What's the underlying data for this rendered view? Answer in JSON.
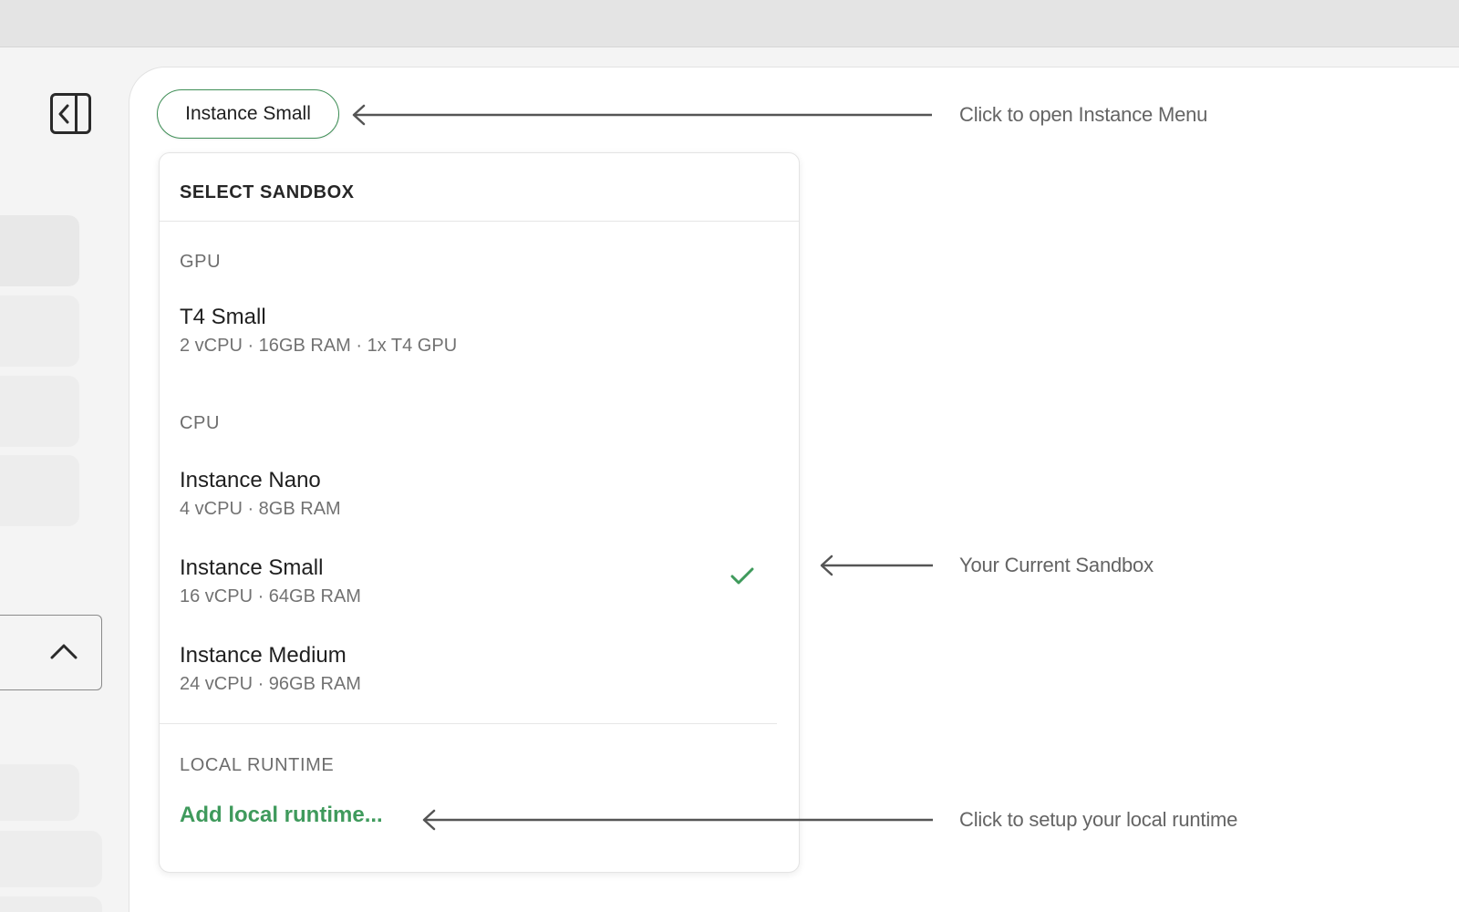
{
  "instance_button": {
    "label": "Instance Small"
  },
  "dropdown": {
    "header": "SELECT SANDBOX",
    "sections": [
      {
        "label": "GPU",
        "options": [
          {
            "name": "T4 Small",
            "specs": "2 vCPU · 16GB RAM · 1x T4 GPU",
            "selected": false
          }
        ]
      },
      {
        "label": "CPU",
        "options": [
          {
            "name": "Instance Nano",
            "specs": "4 vCPU · 8GB RAM",
            "selected": false
          },
          {
            "name": "Instance Small",
            "specs": "16 vCPU · 64GB RAM",
            "selected": true
          },
          {
            "name": "Instance Medium",
            "specs": "24 vCPU · 96GB RAM",
            "selected": false
          }
        ]
      },
      {
        "label": "LOCAL RUNTIME",
        "options": []
      }
    ],
    "add_runtime_label": "Add local runtime..."
  },
  "annotations": {
    "open_menu": "Click to open Instance Menu",
    "current_sandbox": "Your Current Sandbox",
    "local_runtime": "Click to setup your local runtime"
  },
  "icons": {
    "sidebar_toggle": "sidebar-collapse-icon",
    "collapse": "chevron-up-icon",
    "selected": "check-icon",
    "arrow": "arrow-left-icon"
  },
  "colors": {
    "accent_green": "#3f9a5c",
    "button_border": "#3f8f57",
    "annotation_text": "#646464"
  }
}
